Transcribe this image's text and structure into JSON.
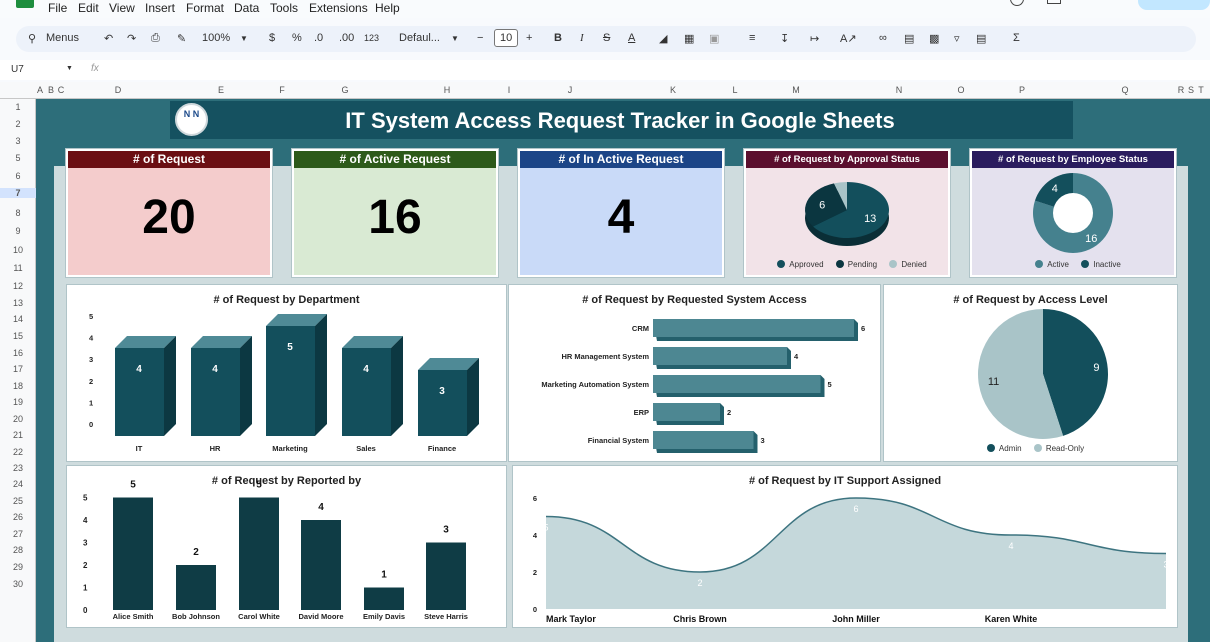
{
  "menu": [
    "File",
    "Edit",
    "View",
    "Insert",
    "Format",
    "Data",
    "Tools",
    "Extensions",
    "Help"
  ],
  "toolbar": {
    "search": "Menus",
    "zoom": "100%",
    "currency": "$",
    "percent": "%",
    "dec_less": ".0",
    "dec_more": ".00",
    "format": "123",
    "font": "Defaul...",
    "font_size": "10"
  },
  "formula_bar": {
    "cell_ref": "U7",
    "fx": "fx"
  },
  "columns": [
    "A",
    "B",
    "C",
    "D",
    "E",
    "F",
    "G",
    "H",
    "I",
    "J",
    "K",
    "L",
    "M",
    "N",
    "O",
    "P",
    "Q",
    "R",
    "S",
    "T"
  ],
  "rows": [
    "1",
    "2",
    "3",
    "5",
    "6",
    "7",
    "8",
    "9",
    "10",
    "11",
    "12",
    "13",
    "14",
    "15",
    "16",
    "17",
    "18",
    "19",
    "20",
    "21",
    "22",
    "23",
    "24",
    "25",
    "26",
    "27",
    "28",
    "29",
    "30"
  ],
  "dashboard": {
    "title": "IT System Access Request Tracker in Google Sheets",
    "logo_text": "N N",
    "kpis": [
      {
        "label": "# of Request",
        "value": "20",
        "head_color": "#6b0f13",
        "body_color": "#f4cccc"
      },
      {
        "label": "# of Active Request",
        "value": "16",
        "head_color": "#2d5a1a",
        "body_color": "#d9ead3"
      },
      {
        "label": "# of In Active Request",
        "value": "4",
        "head_color": "#1c4587",
        "body_color": "#c9daf8"
      }
    ],
    "approval": {
      "title": "# of Request by Approval Status",
      "legend": [
        "Approved",
        "Pending",
        "Denied"
      ]
    },
    "employee": {
      "title": "# of Request by Employee Status",
      "legend": [
        "Active",
        "Inactive"
      ]
    },
    "department_title": "# of Request by Department",
    "system_title": "# of Request by Requested System Access",
    "access_title": "# of Request by Access Level",
    "access_legend": [
      "Admin",
      "Read-Only"
    ],
    "reported_title": "# of Request by Reported by",
    "support_title": "# of Request by IT Support Assigned"
  },
  "chart_data": [
    {
      "type": "pie",
      "title": "# of Request by Approval Status",
      "labels": [
        "Approved",
        "Pending",
        "Denied"
      ],
      "values": [
        13,
        6,
        1
      ],
      "colors": [
        "#134f5c",
        "#0b3640",
        "#a9c4c8"
      ]
    },
    {
      "type": "pie",
      "title": "# of Request by Employee Status",
      "labels": [
        "Active",
        "Inactive"
      ],
      "values": [
        16,
        4
      ],
      "colors": [
        "#45818e",
        "#134f5c"
      ]
    },
    {
      "type": "bar",
      "title": "# of Request by Department",
      "categories": [
        "IT",
        "HR",
        "Marketing",
        "Sales",
        "Finance"
      ],
      "values": [
        4,
        4,
        5,
        4,
        3
      ],
      "yticks": [
        0,
        1,
        2,
        3,
        4,
        5
      ],
      "ylim": [
        0,
        5
      ]
    },
    {
      "type": "bar",
      "orientation": "horizontal",
      "title": "# of Request by Requested System Access",
      "categories": [
        "CRM",
        "HR Management System",
        "Marketing Automation System",
        "ERP",
        "Financial System"
      ],
      "values": [
        6,
        4,
        5,
        2,
        3
      ]
    },
    {
      "type": "pie",
      "title": "# of Request by Access Level",
      "labels": [
        "Admin",
        "Read-Only"
      ],
      "values": [
        9,
        11
      ],
      "colors": [
        "#134f5c",
        "#a9c4c8"
      ]
    },
    {
      "type": "bar",
      "title": "# of Request by Reported by",
      "categories": [
        "Alice Smith",
        "Bob Johnson",
        "Carol White",
        "David Moore",
        "Emily Davis",
        "Steve Harris"
      ],
      "values": [
        5,
        2,
        5,
        4,
        1,
        3
      ],
      "yticks": [
        0,
        1,
        2,
        3,
        4,
        5
      ],
      "ylim": [
        0,
        5
      ]
    },
    {
      "type": "area",
      "title": "# of Request by IT Support Assigned",
      "categories": [
        "Mark Taylor",
        "Chris Brown",
        "John Miller",
        "Karen White"
      ],
      "values": [
        5,
        2,
        6,
        4,
        3
      ],
      "yticks": [
        0,
        2,
        4,
        6
      ],
      "ylim": [
        0,
        6
      ]
    }
  ]
}
